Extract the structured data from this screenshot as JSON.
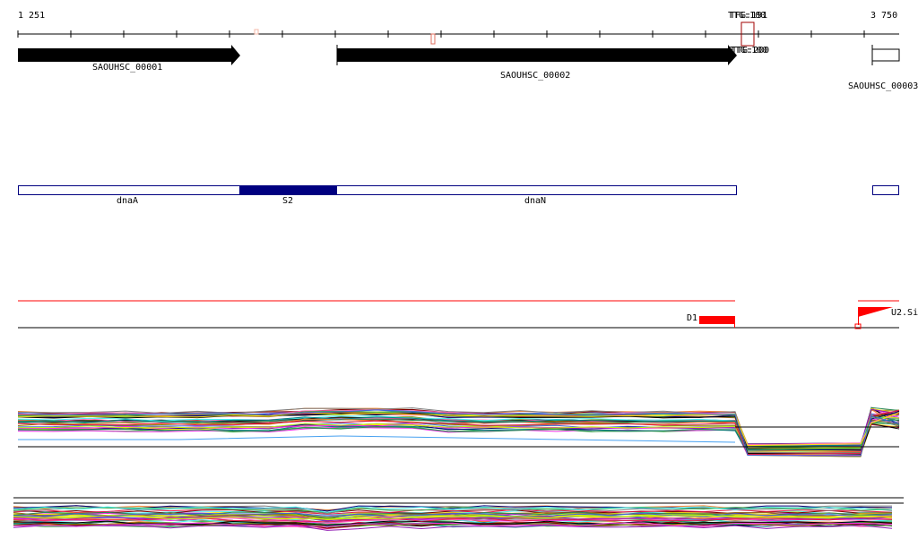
{
  "ruler": {
    "start": "1 251",
    "end": "3 750",
    "mark_top": "TTG:100",
    "mark_top2": "TFG:191",
    "mark_bottom": "TTG:100",
    "mark_bottom2": "TTG:200"
  },
  "genes": [
    {
      "label": "SAOUHSC_00001"
    },
    {
      "label": "SAOUHSC_00002"
    },
    {
      "label": "SAOUHSC_00003"
    }
  ],
  "regions": [
    {
      "label": "dnaA"
    },
    {
      "label": "S2"
    },
    {
      "label": "dnaN"
    }
  ],
  "features": {
    "d1": "D1",
    "u2": "U2.Si"
  },
  "colors": {
    "accent": "#ff0000",
    "region": "#000080"
  },
  "line_colors": [
    "#e6194b",
    "#3cb44b",
    "#ffe119",
    "#4363d8",
    "#f58231",
    "#911eb4",
    "#46f0f0",
    "#f032e6",
    "#bcf60c",
    "#008080",
    "#9a6324",
    "#800000",
    "#808000",
    "#000075",
    "#808080",
    "#000000",
    "#ff69b4",
    "#2e8b57"
  ]
}
